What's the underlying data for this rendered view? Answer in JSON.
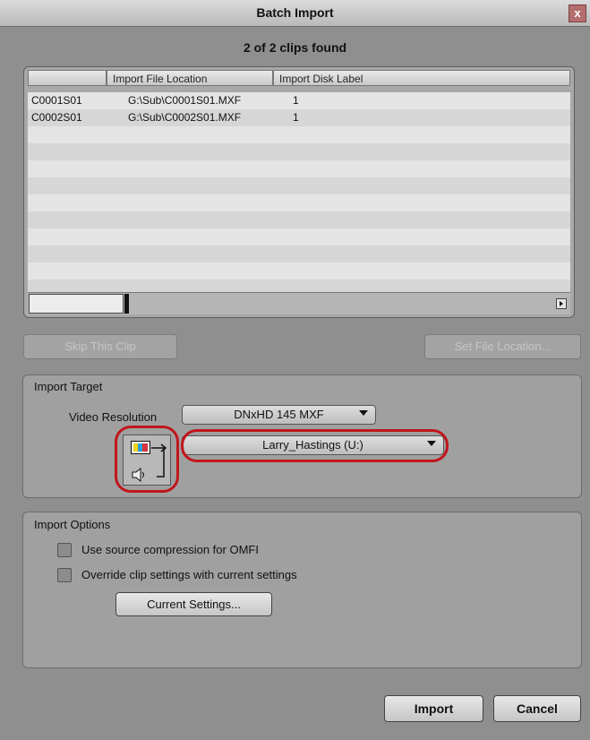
{
  "window": {
    "title": "Batch Import",
    "close_glyph": "x"
  },
  "status": {
    "found": "2 of 2 clips found"
  },
  "table": {
    "columns": [
      "",
      "Import File Location",
      "Import Disk Label"
    ],
    "rows": [
      {
        "clip": "C0001S01",
        "location": "G:\\Sub\\C0001S01.MXF",
        "label": "1"
      },
      {
        "clip": "C0002S01",
        "location": "G:\\Sub\\C0002S01.MXF",
        "label": "1"
      }
    ]
  },
  "buttons": {
    "skip_clip": "Skip This Clip",
    "set_file_location": "Set File Location...",
    "current_settings": "Current Settings...",
    "import": "Import",
    "cancel": "Cancel"
  },
  "import_target": {
    "group_label": "Import Target",
    "video_resolution_label": "Video Resolution",
    "video_resolution_value": "DNxHD 145  MXF",
    "target_drive_value": "Larry_Hastings (U:)"
  },
  "import_options": {
    "group_label": "Import Options",
    "options": [
      {
        "label": "Use source compression for OMFI",
        "checked": false
      },
      {
        "label": "Override clip settings with current settings",
        "checked": false
      }
    ]
  },
  "icons": {
    "video_track": "video-track-icon",
    "audio_track": "speaker-icon",
    "scroll_right": "arrow-right-icon",
    "dropdown": "chevron-down-icon"
  },
  "colors": {
    "highlight": "#c0161c",
    "dialog_bg": "#8f8f8f"
  }
}
